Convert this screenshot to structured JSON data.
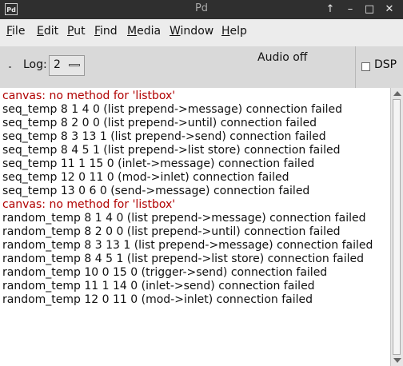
{
  "window": {
    "title": "Pd",
    "icon_text": "Pd",
    "controls": {
      "up": "↑",
      "minimize": "–",
      "maximize": "□",
      "close": "✕"
    }
  },
  "menu": [
    "File",
    "Edit",
    "Put",
    "Find",
    "Media",
    "Window",
    "Help"
  ],
  "toolbar": {
    "log_label": "Log:",
    "log_value": "2",
    "audio_status": "Audio off",
    "dsp_label": "DSP",
    "dsp_checked": false
  },
  "console": {
    "error_color": "#b00000",
    "lines": [
      {
        "text": "canvas: no method for 'listbox'",
        "error": true
      },
      {
        "text": "seq_temp 8 1 4 0 (list prepend->message) connection failed",
        "error": false
      },
      {
        "text": "seq_temp 8 2 0 0 (list prepend->until) connection failed",
        "error": false
      },
      {
        "text": "seq_temp 8 3 13 1 (list prepend->send) connection failed",
        "error": false
      },
      {
        "text": "seq_temp 8 4 5 1 (list prepend->list store) connection failed",
        "error": false
      },
      {
        "text": "seq_temp 11 1 15 0 (inlet->message) connection failed",
        "error": false
      },
      {
        "text": "seq_temp 12 0 11 0 (mod->inlet) connection failed",
        "error": false
      },
      {
        "text": "seq_temp 13 0 6 0 (send->message) connection failed",
        "error": false
      },
      {
        "text": "canvas: no method for 'listbox'",
        "error": true
      },
      {
        "text": "random_temp 8 1 4 0 (list prepend->message) connection failed",
        "error": false
      },
      {
        "text": "random_temp 8 2 0 0 (list prepend->until) connection failed",
        "error": false
      },
      {
        "text": "random_temp 8 3 13 1 (list prepend->message) connection failed",
        "error": false
      },
      {
        "text": "random_temp 8 4 5 1 (list prepend->list store) connection failed",
        "error": false
      },
      {
        "text": "random_temp 10 0 15 0 (trigger->send) connection failed",
        "error": false
      },
      {
        "text": "random_temp 11 1 14 0 (inlet->send) connection failed",
        "error": false
      },
      {
        "text": "random_temp 12 0 11 0 (mod->inlet) connection failed",
        "error": false
      }
    ]
  }
}
